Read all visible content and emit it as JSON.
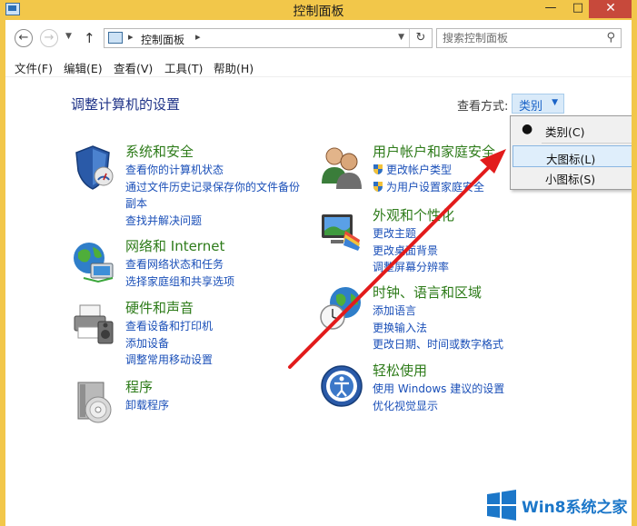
{
  "window": {
    "title": "控制面板"
  },
  "colors": {
    "titlebar": "#f2c74a",
    "close": "#c7493b",
    "link": "#1a4fb8",
    "category": "#2d7b19",
    "heading": "#1e3287",
    "arrow": "#e21b1b"
  },
  "address": {
    "crumb": "控制面板",
    "search_placeholder": "搜索控制面板"
  },
  "menu": [
    "文件(F)",
    "编辑(E)",
    "查看(V)",
    "工具(T)",
    "帮助(H)"
  ],
  "main": {
    "heading": "调整计算机的设置",
    "viewby_label": "查看方式:",
    "viewby_value": "类别"
  },
  "dropdown": {
    "items": [
      "类别(C)",
      "大图标(L)",
      "小图标(S)"
    ],
    "selected": "类别(C)",
    "hover": "大图标(L)"
  },
  "categories": [
    {
      "title": "系统和安全",
      "icon": "shield-icon",
      "links": [
        "查看你的计算机状态",
        "通过文件历史记录保存你的文件备份",
        "副本",
        "查找并解决问题"
      ]
    },
    {
      "title": "网络和 Internet",
      "icon": "network-globe-icon",
      "links": [
        "查看网络状态和任务",
        "选择家庭组和共享选项"
      ]
    },
    {
      "title": "硬件和声音",
      "icon": "printer-icon",
      "links": [
        "查看设备和打印机",
        "添加设备",
        "调整常用移动设置"
      ]
    },
    {
      "title": "程序",
      "icon": "programs-disc-icon",
      "links": [
        "卸载程序"
      ]
    },
    {
      "title": "用户帐户和家庭安全",
      "icon": "users-icon",
      "links": [
        "更改帐户类型",
        "为用户设置家庭安全"
      ]
    },
    {
      "title": "外观和个性化",
      "icon": "appearance-monitor-icon",
      "links": [
        "更改主题",
        "更改桌面背景",
        "调整屏幕分辨率"
      ]
    },
    {
      "title": "时钟、语言和区域",
      "icon": "clock-globe-icon",
      "links": [
        "添加语言",
        "更换输入法",
        "更改日期、时间或数字格式"
      ]
    },
    {
      "title": "轻松使用",
      "icon": "ease-of-access-icon",
      "links": [
        "使用 Windows 建议的设置",
        "优化视觉显示"
      ]
    }
  ],
  "watermark": {
    "text": "Win8系统之家",
    "icon": "windows-logo-icon"
  }
}
